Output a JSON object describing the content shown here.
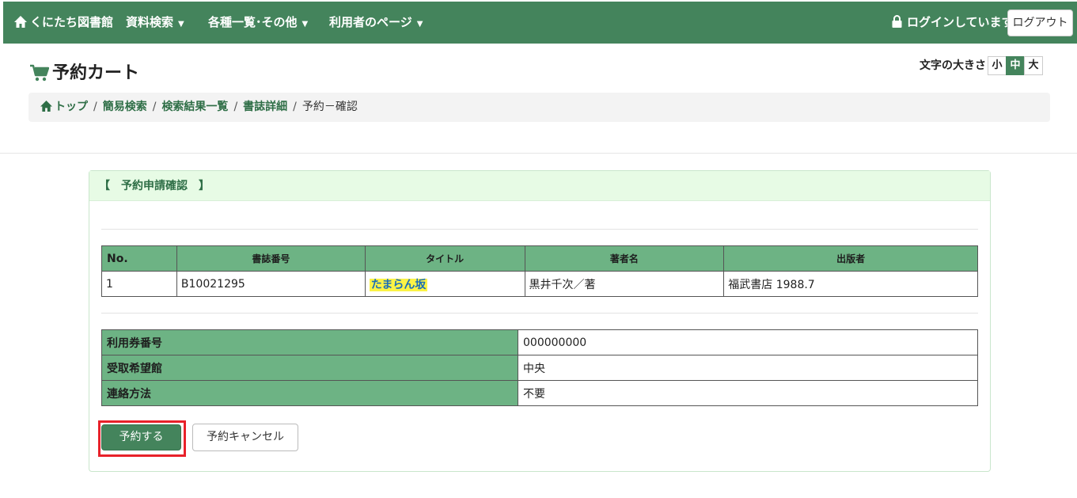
{
  "nav": {
    "home": "くにたち図書館",
    "search": "資料検索",
    "lists": "各種一覧･その他",
    "user_page": "利用者のページ",
    "login_status": "ログインしています",
    "logout": "ログアウト"
  },
  "page": {
    "title": "予約カート",
    "font_size_label": "文字の大きさ",
    "font_sizes": [
      "小",
      "中",
      "大"
    ],
    "font_size_selected": "中"
  },
  "breadcrumb": {
    "items": [
      "トップ",
      "簡易検索",
      "検索結果一覧",
      "書誌詳細"
    ],
    "current": "予約－確認"
  },
  "panel": {
    "heading": "【　予約申請確認　】"
  },
  "books_table": {
    "headers": [
      "No.",
      "書誌番号",
      "タイトル",
      "著者名",
      "出版者"
    ],
    "rows": [
      {
        "no": "1",
        "bib_no": "B10021295",
        "title": "たまらん坂",
        "author": "黒井千次／著",
        "publisher": "福武書店 1988.7"
      }
    ]
  },
  "info_table": [
    {
      "label": "利用券番号",
      "value": "000000000"
    },
    {
      "label": "受取希望館",
      "value": "中央"
    },
    {
      "label": "連絡方法",
      "value": "不要"
    }
  ],
  "buttons": {
    "reserve": "予約する",
    "cancel": "予約キャンセル"
  },
  "colors": {
    "nav_bg": "#44845c",
    "table_header": "#6db384",
    "panel_head": "#e7fbe5",
    "highlight_box": "#e8212a"
  }
}
